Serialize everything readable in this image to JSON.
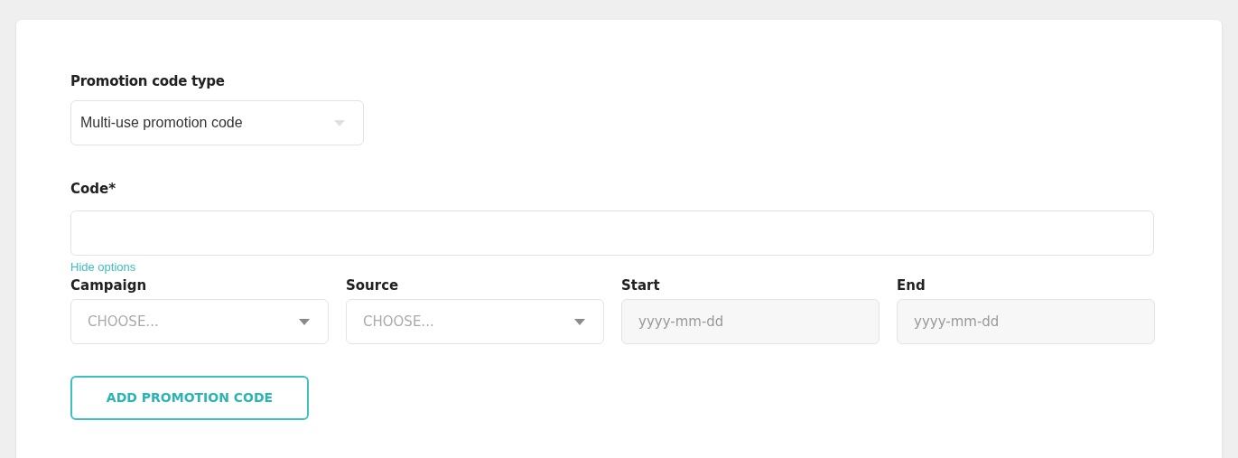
{
  "promotion_type": {
    "label": "Promotion code type",
    "value": "Multi-use promotion code"
  },
  "code": {
    "label": "Code*"
  },
  "options_toggle": "Hide options",
  "options": [
    {
      "kind": "select",
      "label": "Campaign",
      "placeholder": "CHOOSE..."
    },
    {
      "kind": "select",
      "label": "Source",
      "placeholder": "CHOOSE..."
    },
    {
      "kind": "date",
      "label": "Start",
      "placeholder": "yyyy-mm-dd"
    },
    {
      "kind": "date",
      "label": "End",
      "placeholder": "yyyy-mm-dd"
    }
  ],
  "submit_button": "ADD PROMOTION CODE"
}
